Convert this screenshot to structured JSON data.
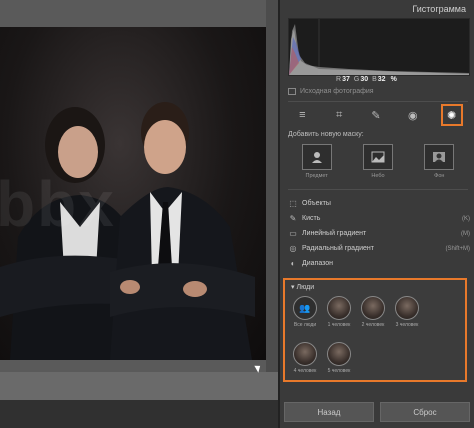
{
  "histogram": {
    "title": "Гистограмма",
    "readout": {
      "r_label": "R",
      "r_value": "37",
      "g_label": "G",
      "g_value": "30",
      "b_label": "B",
      "b_value": "32",
      "unit": "%"
    },
    "original_label": "Исходная фотография"
  },
  "toolbar": {
    "icons": [
      "sliders-icon",
      "crop-icon",
      "brush-icon",
      "eye-icon",
      "mask-icon"
    ]
  },
  "masks": {
    "add_label": "Добавить новую маску:",
    "options": [
      {
        "label": "Предмет",
        "icon": "subject-icon"
      },
      {
        "label": "Небо",
        "icon": "sky-icon"
      },
      {
        "label": "Фон",
        "icon": "background-icon"
      }
    ]
  },
  "tools": [
    {
      "label": "Объекты",
      "shortcut": "",
      "icon": "objects-icon"
    },
    {
      "label": "Кисть",
      "shortcut": "(K)",
      "icon": "brush-icon"
    },
    {
      "label": "Линейный градиент",
      "shortcut": "(M)",
      "icon": "linear-gradient-icon"
    },
    {
      "label": "Радиальный градиент",
      "shortcut": "(Shift+M)",
      "icon": "radial-gradient-icon"
    },
    {
      "label": "Диапазон",
      "shortcut": "",
      "icon": "range-icon"
    }
  ],
  "people": {
    "title": "Люди",
    "items": [
      "Все люди",
      "1 человек",
      "2 человек",
      "3 человек",
      "4 человек",
      "5 человек"
    ]
  },
  "buttons": {
    "back": "Назад",
    "reset": "Сброс"
  },
  "accent": "#e8792b"
}
